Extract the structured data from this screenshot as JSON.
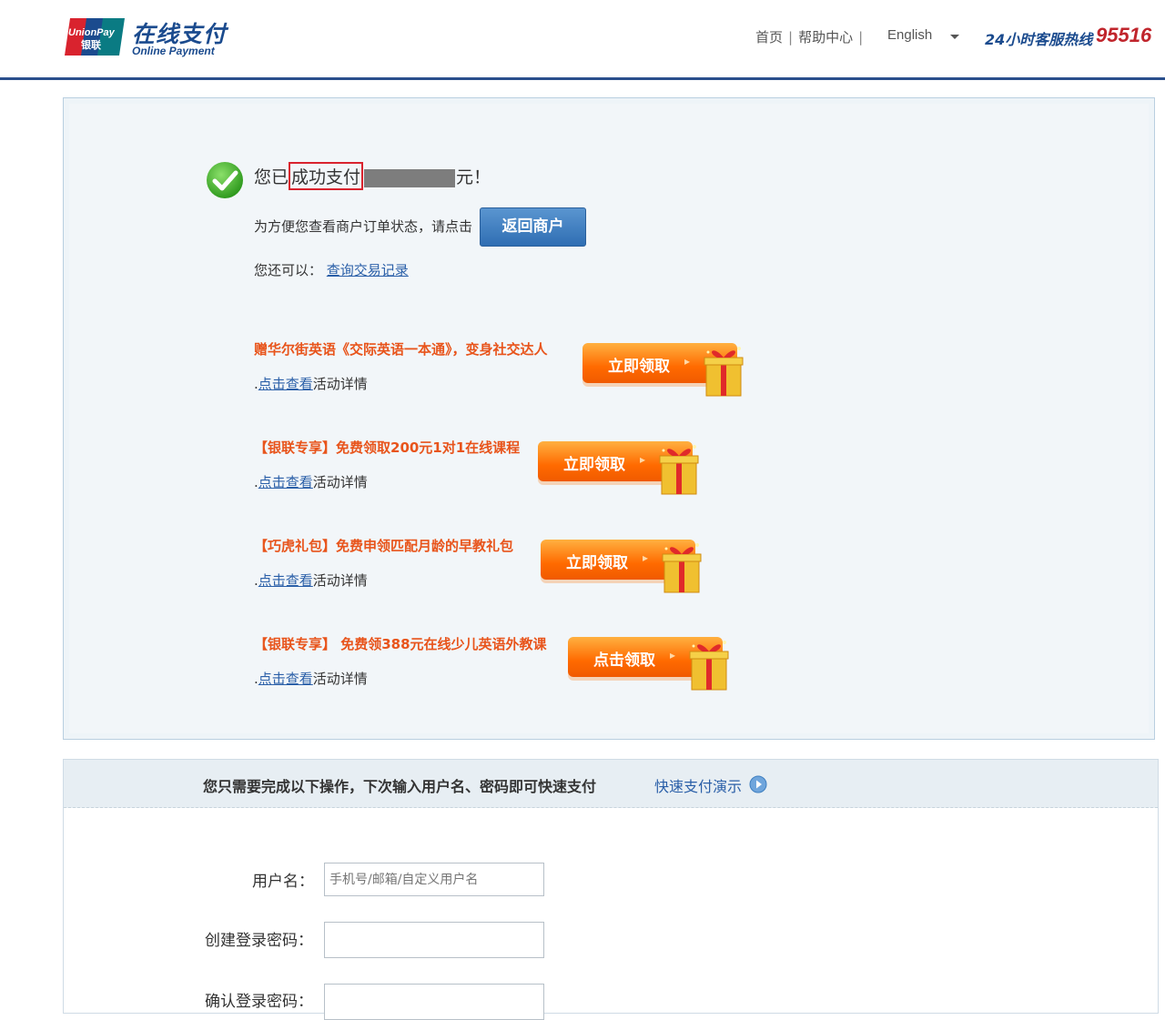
{
  "header": {
    "logo_badge_text": "UnionPay 银联",
    "logo_cn": "在线支付",
    "logo_en": "Online Payment",
    "nav": [
      "首页",
      "帮助中心"
    ],
    "nav_sep": "|",
    "language": "English",
    "hotline_label": "24小时客服热线",
    "hotline_number": "95516"
  },
  "success": {
    "prefix": "您已",
    "highlight": "成功支付",
    "suffix": "元！",
    "hint": "为方便您查看商户订单状态，请点击",
    "return_button": "返回商户",
    "also_label": "您还可以：",
    "history_link": "查询交易记录"
  },
  "promos": [
    {
      "title": "赠华尔街英语《交际英语一本通》，变身社交达人",
      "link": "点击查看",
      "detail": "活动详情",
      "button": "立即领取"
    },
    {
      "title": "【银联专享】免费领取200元1对1在线课程",
      "link": "点击查看",
      "detail": "活动详情",
      "button": "立即领取"
    },
    {
      "title": "【巧虎礼包】免费申领匹配月龄的早教礼包",
      "link": "点击查看",
      "detail": "活动详情",
      "button": "立即领取"
    },
    {
      "title": "【银联专享】 免费领388元在线少儿英语外教课",
      "link": "点击查看",
      "detail": "活动详情",
      "button": "点击领取"
    }
  ],
  "register": {
    "message": "您只需要完成以下操作，下次输入用户名、密码即可快速支付",
    "demo_link": "快速支付演示",
    "username_label": "用户名：",
    "username_placeholder": "手机号/邮箱/自定义用户名",
    "password_label": "创建登录密码：",
    "confirm_label": "确认登录密码："
  },
  "colors": {
    "brand_blue": "#1b4b8e",
    "hotline_red": "#c0252c",
    "promo_orange": "#e8541b",
    "link_blue": "#2a5fa8"
  }
}
